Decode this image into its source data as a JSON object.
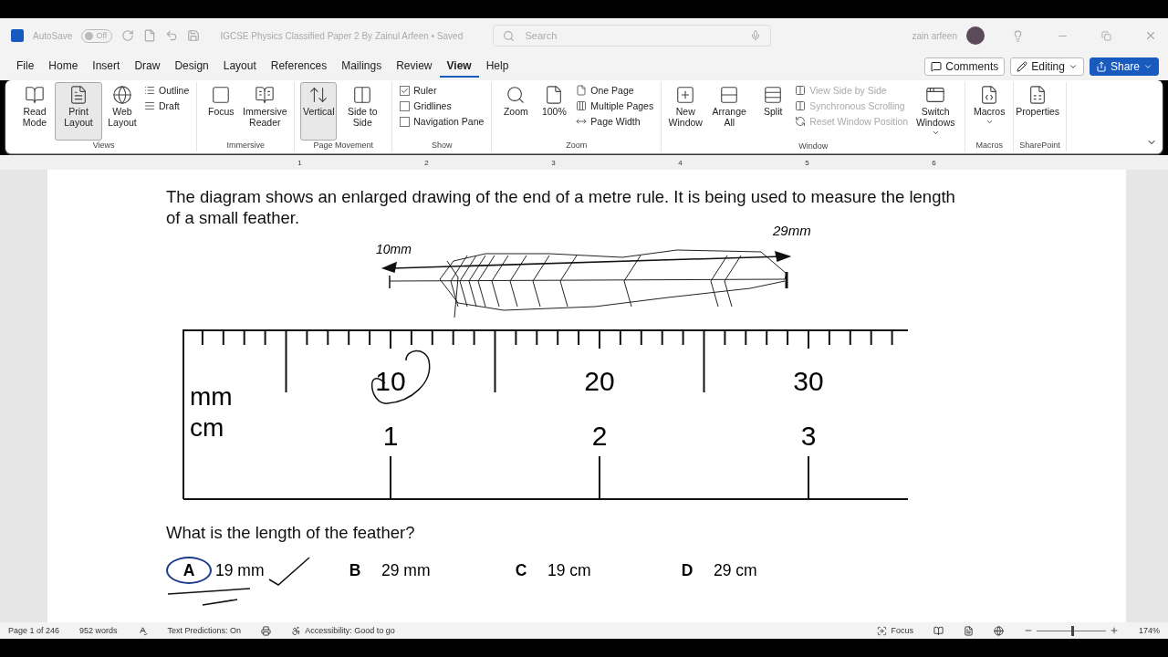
{
  "title_bar": {
    "autosave_label": "AutoSave",
    "autosave_state": "Off",
    "autosave_on": false,
    "document_title": "IGCSE Physics Classified Paper 2 By Zainul Arfeen • Saved",
    "search_placeholder": "Search",
    "user_name": "zain arfeen"
  },
  "menu_tabs": [
    {
      "label": "File",
      "selected": false
    },
    {
      "label": "Home",
      "selected": false
    },
    {
      "label": "Insert",
      "selected": false
    },
    {
      "label": "Draw",
      "selected": false
    },
    {
      "label": "Design",
      "selected": false
    },
    {
      "label": "Layout",
      "selected": false
    },
    {
      "label": "References",
      "selected": false
    },
    {
      "label": "Mailings",
      "selected": false
    },
    {
      "label": "Review",
      "selected": false
    },
    {
      "label": "View",
      "selected": true
    },
    {
      "label": "Help",
      "selected": false
    }
  ],
  "actions": {
    "comments": "Comments",
    "editing": "Editing",
    "share": "Share"
  },
  "ribbon_groups": [
    {
      "name": "Views",
      "items": [
        {
          "kind": "large",
          "label": "Read Mode",
          "selected": false
        },
        {
          "kind": "large",
          "label": "Print Layout",
          "selected": true
        },
        {
          "kind": "large",
          "label": "Web Layout",
          "selected": false
        },
        {
          "kind": "small",
          "label": "Outline",
          "disabled": false
        },
        {
          "kind": "small",
          "label": "Draft",
          "disabled": false
        }
      ]
    },
    {
      "name": "Immersive",
      "items": [
        {
          "kind": "large",
          "label": "Focus",
          "selected": false
        },
        {
          "kind": "large",
          "label": "Immersive Reader",
          "selected": false
        }
      ]
    },
    {
      "name": "Page Movement",
      "items": [
        {
          "kind": "large",
          "label": "Vertical",
          "selected": true
        },
        {
          "kind": "large",
          "label": "Side to Side",
          "selected": false
        }
      ]
    },
    {
      "name": "Show",
      "items": [
        {
          "kind": "check",
          "label": "Ruler",
          "checked": true
        },
        {
          "kind": "check",
          "label": "Gridlines",
          "checked": false
        },
        {
          "kind": "check",
          "label": "Navigation Pane",
          "checked": false
        }
      ]
    },
    {
      "name": "Zoom",
      "items": [
        {
          "kind": "large",
          "label": "Zoom",
          "selected": false
        },
        {
          "kind": "large",
          "label": "100%",
          "selected": false
        },
        {
          "kind": "small",
          "label": "One Page",
          "disabled": false
        },
        {
          "kind": "small",
          "label": "Multiple Pages",
          "disabled": false
        },
        {
          "kind": "small",
          "label": "Page Width",
          "disabled": false
        }
      ]
    },
    {
      "name": "Window",
      "items": [
        {
          "kind": "large",
          "label": "New Window",
          "selected": false
        },
        {
          "kind": "large",
          "label": "Arrange All",
          "selected": false
        },
        {
          "kind": "large",
          "label": "Split",
          "selected": false
        },
        {
          "kind": "small",
          "label": "View Side by Side",
          "disabled": true
        },
        {
          "kind": "small",
          "label": "Synchronous Scrolling",
          "disabled": true
        },
        {
          "kind": "small",
          "label": "Reset Window Position",
          "disabled": true
        },
        {
          "kind": "large",
          "label": "Switch Windows",
          "selected": false,
          "dropdown": true
        }
      ]
    },
    {
      "name": "Macros",
      "items": [
        {
          "kind": "large",
          "label": "Macros",
          "selected": false,
          "dropdown": true
        }
      ]
    },
    {
      "name": "SharePoint",
      "items": [
        {
          "kind": "large",
          "label": "Properties",
          "selected": false
        }
      ]
    }
  ],
  "ruler_numbers": [
    "1",
    "2",
    "3",
    "4",
    "5",
    "6"
  ],
  "document": {
    "question": "The diagram shows an enlarged drawing of the end of a metre rule. It is being used to measure the length of a small feather.",
    "handwritten_notes": [
      "10mm",
      "29mm"
    ],
    "rule": {
      "unit_labels": [
        "mm",
        "cm"
      ],
      "mm_labels": [
        "10",
        "20",
        "30"
      ],
      "cm_labels": [
        "1",
        "2",
        "3"
      ]
    },
    "prompt": "What is the length of the feather?",
    "options": [
      {
        "letter": "A",
        "answer": "19 mm",
        "selected": true
      },
      {
        "letter": "B",
        "answer": "29 mm",
        "selected": false
      },
      {
        "letter": "C",
        "answer": "19 cm",
        "selected": false
      },
      {
        "letter": "D",
        "answer": "29 cm",
        "selected": false
      }
    ]
  },
  "status_bar": {
    "page": "Page 1 of 246",
    "words": "952 words",
    "text_predictions": "Text Predictions: On",
    "accessibility": "Accessibility: Good to go",
    "focus": "Focus",
    "zoom": {
      "level": 0.53,
      "reading": "174%"
    }
  }
}
